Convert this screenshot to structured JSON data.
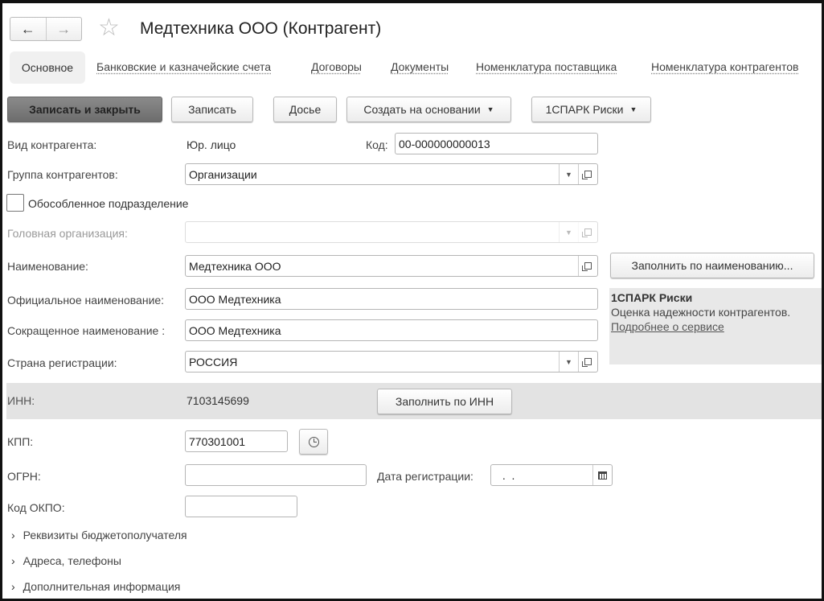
{
  "header": {
    "title": "Медтехника ООО (Контрагент)",
    "back": "←",
    "forward": "→",
    "star": "☆"
  },
  "tabs": [
    "Основное",
    "Банковские и казначейские счета",
    "Договоры",
    "Документы",
    "Номенклатура поставщика",
    "Номенклатура контрагентов"
  ],
  "toolbar": {
    "save_close": "Записать и закрыть",
    "save": "Записать",
    "dossier": "Досье",
    "create_based": "Создать на основании",
    "spark": "1СПАРК Риски"
  },
  "form": {
    "kind_label": "Вид контрагента:",
    "kind_value": "Юр. лицо",
    "code_label": "Код:",
    "code_value": "00-000000000013",
    "group_label": "Группа контрагентов:",
    "group_value": "Организации",
    "separate_label": "Обособленное подразделение",
    "head_label": "Головная организация:",
    "name_label": "Наименование:",
    "name_value": "Медтехника ООО",
    "fill_by_name": "Заполнить по наименованию...",
    "official_label": "Официальное наименование:",
    "official_value": "ООО Медтехника",
    "short_label": "Сокращенное наименование :",
    "short_value": "ООО Медтехника",
    "country_label": "Страна регистрации:",
    "country_value": "РОССИЯ",
    "inn_label": "ИНН:",
    "inn_value": "7103145699",
    "fill_by_inn": "Заполнить по ИНН",
    "kpp_label": "КПП:",
    "kpp_value": "770301001",
    "ogrn_label": "ОГРН:",
    "ogrn_value": "",
    "reg_date_label": "Дата регистрации:",
    "reg_date_value": " .  .",
    "okpo_label": "Код ОКПО:",
    "okpo_value": ""
  },
  "spark_panel": {
    "title": "1СПАРК Риски",
    "desc": "Оценка надежности контрагентов.",
    "link": "Подробнее о сервисе"
  },
  "sections": [
    "Реквизиты бюджетополучателя",
    "Адреса, телефоны",
    "Дополнительная информация"
  ]
}
